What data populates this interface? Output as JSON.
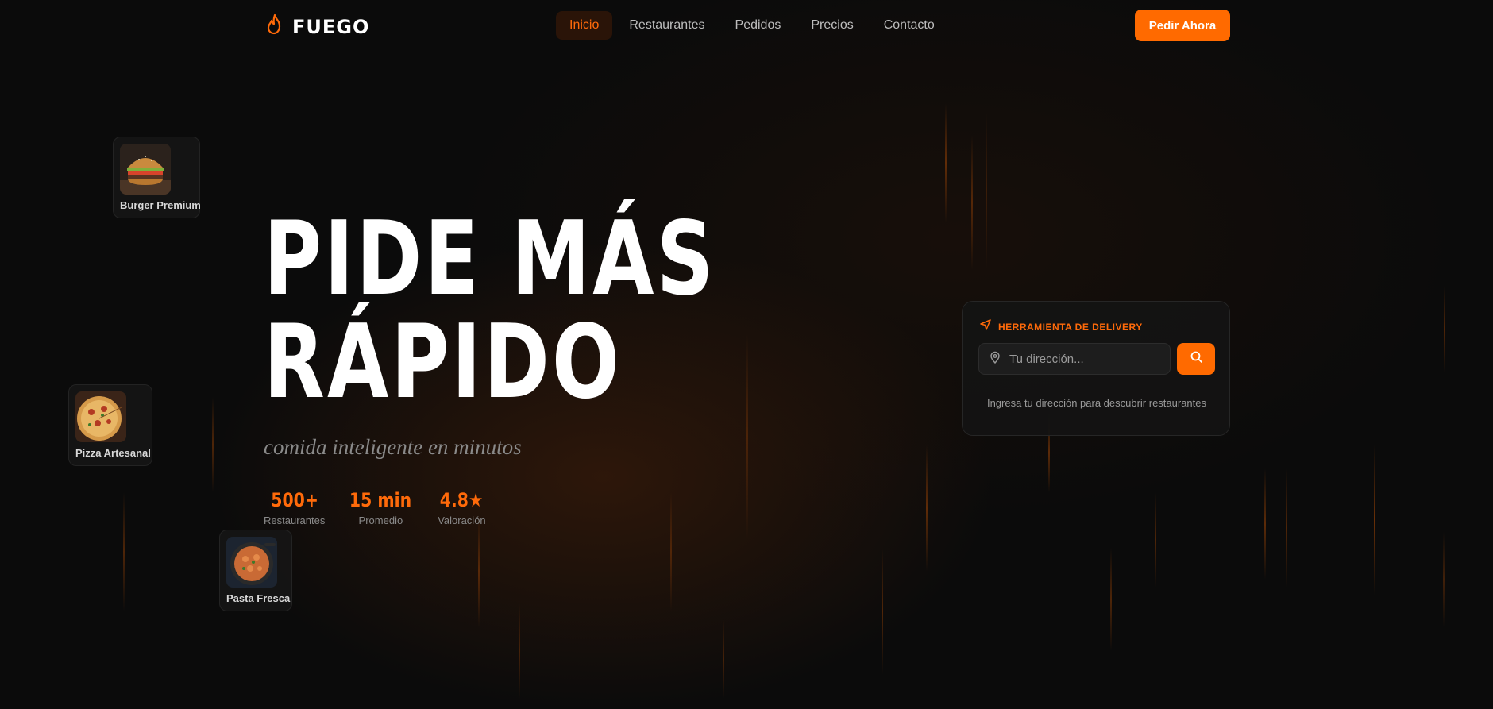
{
  "brand": {
    "name": "FUEGO",
    "icon": "flame-icon",
    "accent": "#ff6a00"
  },
  "nav": {
    "items": [
      {
        "label": "Inicio",
        "active": true
      },
      {
        "label": "Restaurantes",
        "active": false
      },
      {
        "label": "Pedidos",
        "active": false
      },
      {
        "label": "Precios",
        "active": false
      },
      {
        "label": "Contacto",
        "active": false
      }
    ],
    "cta_label": "Pedir Ahora"
  },
  "food_cards": [
    {
      "label": "Burger Premium",
      "image": "burger-image"
    },
    {
      "label": "Pizza Artesanal",
      "image": "pizza-image"
    },
    {
      "label": "Pasta Fresca",
      "image": "pasta-image"
    }
  ],
  "hero": {
    "title_line1": "PIDE MÁS",
    "title_line2": "RÁPIDO",
    "subtitle": "comida inteligente en minutos",
    "stats": [
      {
        "value": "500+",
        "label": "Restaurantes"
      },
      {
        "value": "15 min",
        "label": "Promedio"
      },
      {
        "value": "4.8★",
        "label": "Valoración"
      }
    ]
  },
  "delivery": {
    "title": "HERRAMIENTA DE DELIVERY",
    "title_icon": "navigation-arrow-icon",
    "input_placeholder": "Tu dirección...",
    "input_value": "",
    "input_icon": "map-pin-icon",
    "search_icon": "search-icon",
    "hint": "Ingresa tu dirección para descubrir restaurantes"
  }
}
